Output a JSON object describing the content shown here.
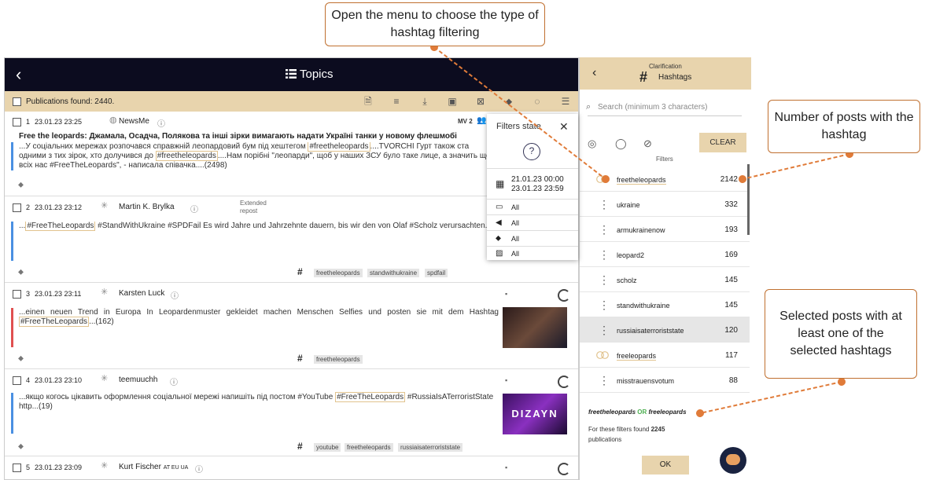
{
  "topbar": {
    "back": "‹",
    "title": "Topics"
  },
  "subbar": {
    "publications": "Publications found: 2440."
  },
  "posts": [
    {
      "num": "1",
      "date": "23.01.23 23:25",
      "author": "NewsMe",
      "mv": "MV 2",
      "title": "Free the leopards: Джамала, Осадча, Полякова та інші зірки вимагають надати Україні танки у новому флешмобі",
      "t1": "...У соціальних мережах розпочався справжній леопардовий бум під хештегом ",
      "h1": "#freetheleopards",
      "t2": "....TVORCHI Гурт також ста",
      "l2a": "одними з тих зірок, хто долучився до ",
      "h2": "#freetheleopards",
      "l2b": "....Нам порібні \"леопарди\", щоб у наших ЗСУ було таке лице, а значить щоб",
      "l3": "всіх нас #FreeTheLeopards\", - написала співачка....(2498)"
    },
    {
      "num": "2",
      "date": "23.01.23 23:12",
      "author": "Martin K. Brylka",
      "ext1": "Extended",
      "ext2": "repost",
      "t1": "...",
      "h1": "#FreeTheLeopards",
      "t2": " #StandWithUkraine #SPDFail  Es wird Jahre und Jahrzehnte dauern, bis wir den von Olaf #Scholz verursachten...(59)",
      "tags": [
        "freetheleopards",
        "standwithukraine",
        "spdfail"
      ]
    },
    {
      "num": "3",
      "date": "23.01.23 23:11",
      "author": "Karsten Luck",
      "t1": "...einen neuen Trend in Europa In Leopardenmuster gekleidet machen Menschen Selfies und posten sie mit dem Hashtag",
      "h1": "#FreeTheLeopards",
      "t2": "...(162)",
      "tags": [
        "freetheleopards"
      ]
    },
    {
      "num": "4",
      "date": "23.01.23 23:10",
      "author": "teemuuchh",
      "t1": "...якщо когось цікавить оформлення соціальної мережі напишіть під постом #YouTube ",
      "h1": "#FreeTheLeopards",
      "t2": " #RussiaIsATerroristState",
      "l2": "http...(19)",
      "thumb": "DIZAYN",
      "tags": [
        "youtube",
        "freetheleopards",
        "russiaisaterroriststate"
      ]
    },
    {
      "num": "5",
      "date": "23.01.23 23:09",
      "author": "Kurt Fischer",
      "flags": "AT EU UA"
    }
  ],
  "filters_state": {
    "title": "Filters state",
    "close": "✕",
    "help": "?",
    "date_from": "21.01.23 00:00",
    "date_to": "23.01.23 23:59",
    "rows": [
      "All",
      "All",
      "All",
      "All"
    ]
  },
  "panel": {
    "clarification": "Clarification",
    "title": "Hashtags",
    "back": "‹",
    "search_placeholder": "Search (minimum 3 characters)",
    "clear": "CLEAR",
    "filters": "Filters",
    "hashtags": [
      {
        "name": "freetheleopards",
        "count": "2142",
        "selected": true
      },
      {
        "name": "ukraine",
        "count": "332"
      },
      {
        "name": "armukrainenow",
        "count": "193"
      },
      {
        "name": "leopard2",
        "count": "169"
      },
      {
        "name": "scholz",
        "count": "145"
      },
      {
        "name": "standwithukraine",
        "count": "145"
      },
      {
        "name": "russiaisaterroriststate",
        "count": "120",
        "hover": true
      },
      {
        "name": "freeleopards",
        "count": "117",
        "selected": true
      },
      {
        "name": "misstrauensvotum",
        "count": "88"
      }
    ],
    "expr_a": "freetheleopards",
    "expr_or": "OR",
    "expr_b": "freeleopards",
    "found_text": "For these filters found ",
    "found_count": "2245",
    "publications": "publications",
    "ok": "OK"
  },
  "callouts": {
    "menu": "Open the menu to choose the type of hashtag filtering",
    "number": "Number of posts with the hashtag",
    "selected": "Selected posts with at least one of the selected hashtags"
  },
  "colors": {
    "header_bg": "#0c0c1f",
    "accent": "#e8d4ad",
    "callout_border": "#c07030",
    "arrow": "#e07b39"
  }
}
